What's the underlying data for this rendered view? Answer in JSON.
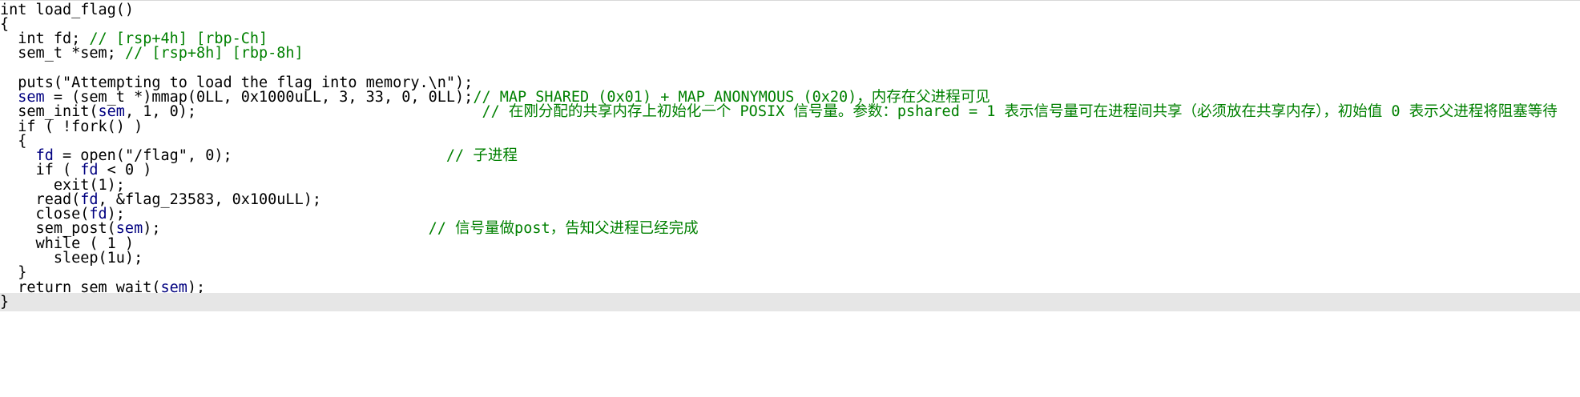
{
  "code": {
    "l01": "int load_flag()",
    "l02": "{",
    "l03": {
      "pre": "  int fd; ",
      "comment": "// [rsp+4h] [rbp-Ch]"
    },
    "l04": {
      "pre": "  sem_t *sem; ",
      "comment": "// [rsp+8h] [rbp-8h]"
    },
    "l05": "",
    "l06": "  puts(\"Attempting to load the flag into memory.\\n\");",
    "l07": {
      "indent": "  ",
      "var": "sem",
      "post": " = (sem_t *)mmap(0LL, 0x1000uLL, 3, 33, 0, 0LL);",
      "comment": "// MAP_SHARED (0x01) + MAP_ANONYMOUS (0x20)，内存在父进程可见"
    },
    "l08": {
      "pre": "  sem_init(",
      "var": "sem",
      "post": ", 1, 0);                                ",
      "comment": "// 在刚分配的共享内存上初始化一个 POSIX 信号量。参数：pshared = 1 表示信号量可在进程间共享（必须放在共享内存），初始值 0 表示父进程将阻塞等待"
    },
    "l09": "  if ( !fork() )",
    "l10": "  {",
    "l11": {
      "indent": "    ",
      "var": "fd",
      "post": " = open(\"/flag\", 0);                        ",
      "comment": "// 子进程"
    },
    "l12": {
      "pre": "    if ( ",
      "var": "fd",
      "post": " < 0 )"
    },
    "l13": "      exit(1);",
    "l14": {
      "pre": "    read(",
      "var": "fd",
      "post": ", &flag_23583, 0x100uLL);"
    },
    "l15": {
      "pre": "    close(",
      "var": "fd",
      "post": ");"
    },
    "l16": {
      "pre": "    sem_post(",
      "var": "sem",
      "post": ");                              ",
      "comment": "// 信号量做post，告知父进程已经完成"
    },
    "l17": "    while ( 1 )",
    "l18": "      sleep(1u);",
    "l19": "  }",
    "l20": {
      "pre": "  return sem_wait(",
      "var": "sem",
      "post": ");"
    },
    "l21": "}"
  },
  "colors": {
    "background": "#ffffff",
    "text": "#000000",
    "variable": "#000080",
    "comment": "#008000",
    "current_line": "#e6e6e6"
  }
}
